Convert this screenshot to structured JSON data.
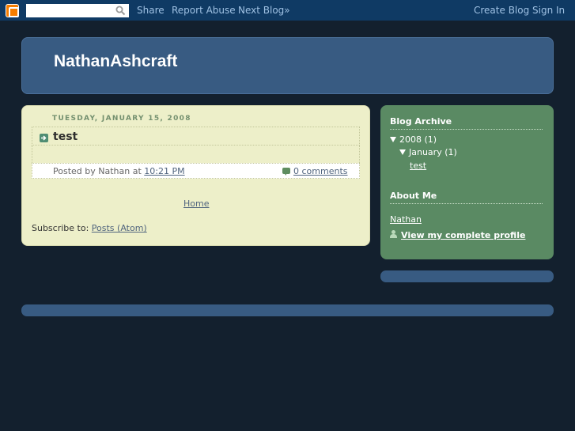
{
  "navbar": {
    "search_placeholder": "",
    "links": {
      "share": "Share",
      "report_abuse": "Report Abuse",
      "next_blog": "Next Blog»",
      "create_blog": "Create Blog",
      "sign_in": "Sign In"
    }
  },
  "header": {
    "title": "NathanAshcraft"
  },
  "post": {
    "date": "TUESDAY, JANUARY 15, 2008",
    "title": "test",
    "posted_by": "Posted by Nathan at",
    "time": "10:21 PM",
    "comments": "0 comments"
  },
  "main": {
    "home_link": "Home",
    "subscribe_label": "Subscribe to:",
    "subscribe_link": "Posts (Atom)"
  },
  "sidebar": {
    "archive_heading": "Blog Archive",
    "archive_year": "2008 (1)",
    "archive_month": "January (1)",
    "archive_post": "test",
    "about_heading": "About Me",
    "author_name": "Nathan",
    "profile_link": "View my complete profile"
  },
  "colors": {
    "page_bg": "#13202e",
    "navbar_bg": "#0f3a64",
    "header_bg": "#385b82",
    "main_bg": "#edefc9",
    "sidebar_bg": "#5a8a63"
  }
}
